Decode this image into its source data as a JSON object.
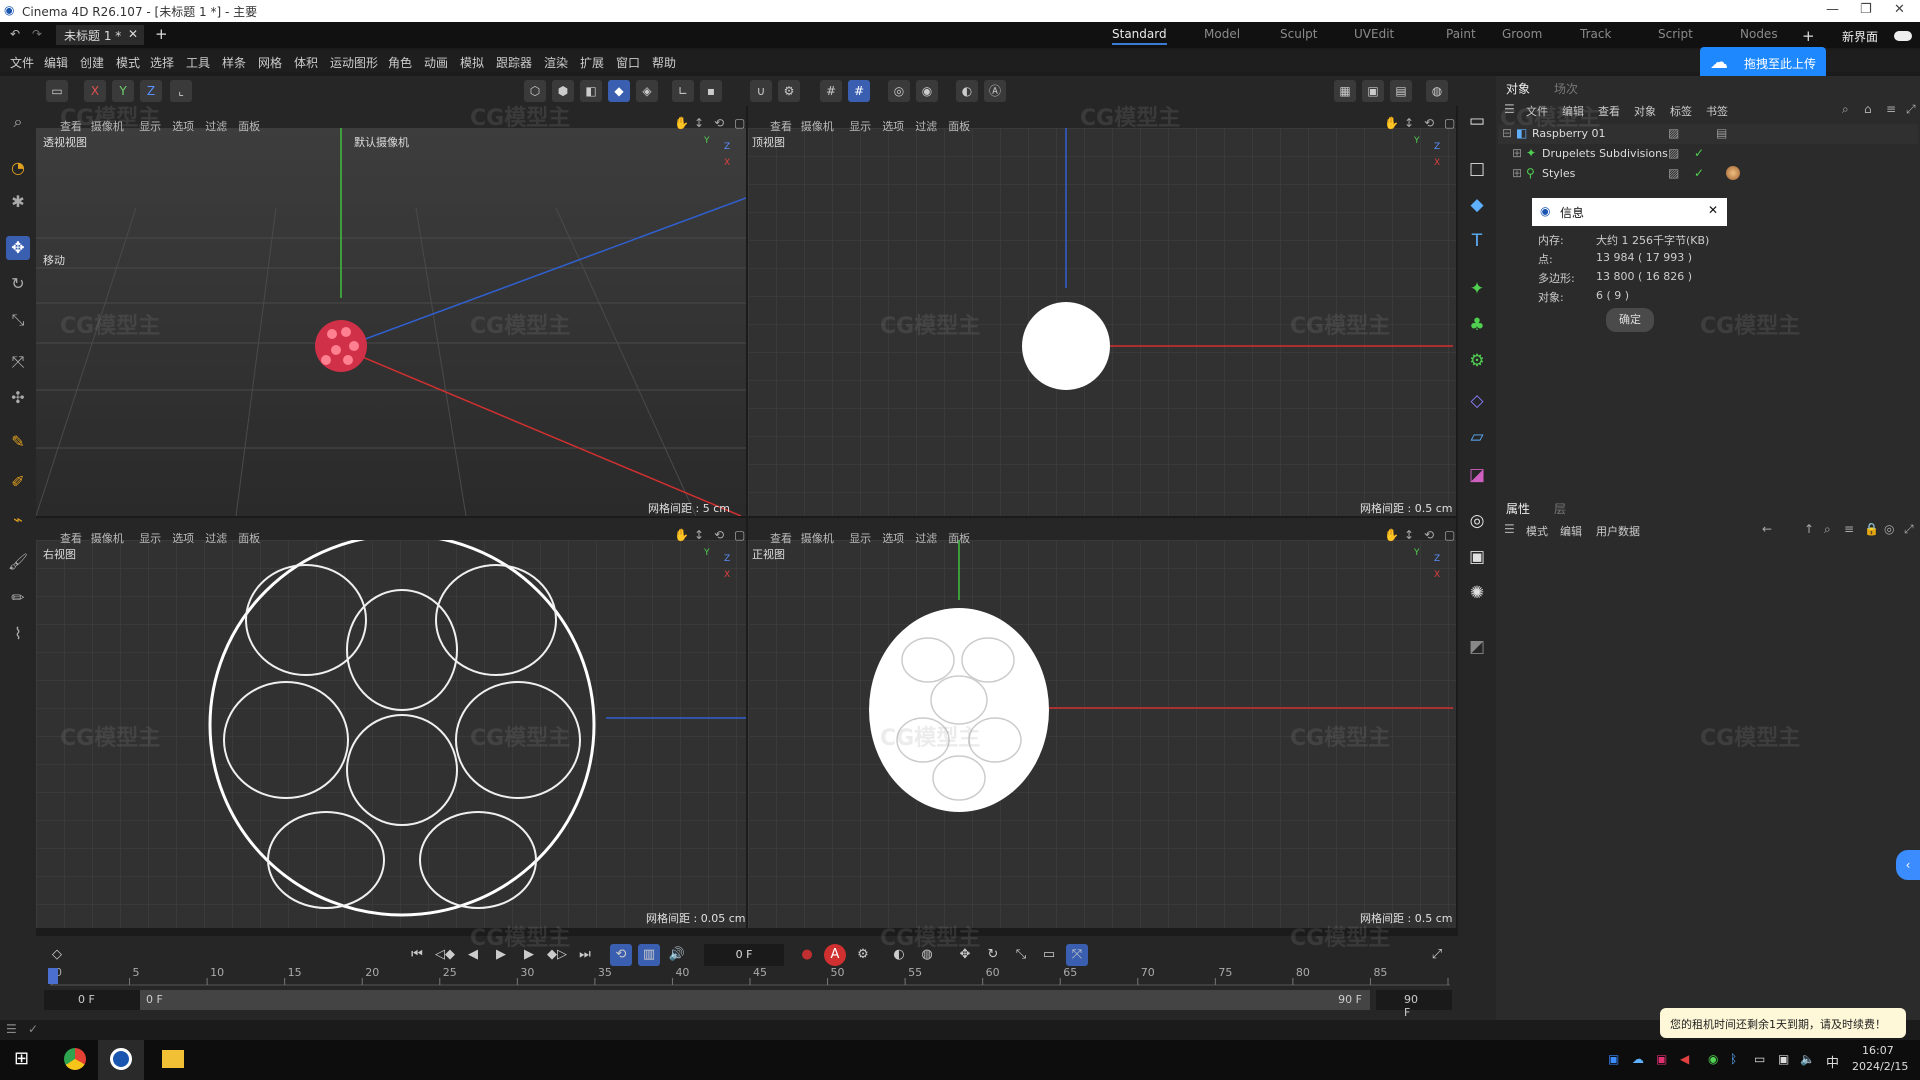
{
  "window": {
    "title": "Cinema 4D R26.107 - [未标题 1 *] - 主要",
    "doc_tab": "未标题 1 *",
    "add_tab": "+"
  },
  "layouts": {
    "items": [
      "Standard",
      "Model",
      "Sculpt",
      "UVEdit",
      "Paint",
      "Groom",
      "Track",
      "Script",
      "Nodes"
    ],
    "active": "Standard",
    "new_ui": "新界面"
  },
  "menu": [
    "文件",
    "编辑",
    "创建",
    "模式",
    "选择",
    "工具",
    "样条",
    "网格",
    "体积",
    "运动图形",
    "角色",
    "动画",
    "模拟",
    "跟踪器",
    "渲染",
    "扩展",
    "窗口",
    "帮助"
  ],
  "upload_button": "拖拽至此上传",
  "toolbar": {
    "axis_x": "X",
    "axis_y": "Y",
    "axis_z": "Z"
  },
  "viewport_menu": [
    "查看",
    "摄像机",
    "显示",
    "选项",
    "过滤",
    "面板"
  ],
  "viewports": {
    "perspective": {
      "label": "透视视图",
      "camera": "默认摄像机",
      "move_label": "移动",
      "grid": "网格间距 : 5 cm"
    },
    "top": {
      "label": "顶视图",
      "grid": "网格间距 : 0.5 cm"
    },
    "right": {
      "label": "右视图",
      "grid": "网格间距 : 0.05 cm"
    },
    "front": {
      "label": "正视图",
      "grid": "网格间距 : 0.5 cm"
    }
  },
  "axis_labels": {
    "x": "X",
    "y": "Y",
    "z": "Z"
  },
  "object_panel": {
    "tabs": [
      "对象",
      "场次"
    ],
    "menu": [
      "文件",
      "编辑",
      "查看",
      "对象",
      "标签",
      "书签"
    ],
    "objects": [
      "Raspberry 01",
      "Drupelets Subdivisions",
      "Styles"
    ]
  },
  "info_dialog": {
    "title": "信息",
    "rows": [
      {
        "k": "内存:",
        "v": "大约 1 256千字节(KB)"
      },
      {
        "k": "点:",
        "v": "13 984 ( 17 993 )"
      },
      {
        "k": "多边形:",
        "v": "13 800 ( 16 826 )"
      },
      {
        "k": "对象:",
        "v": "6 ( 9 )"
      }
    ],
    "ok": "确定"
  },
  "attr_panel": {
    "tabs": [
      "属性",
      "层"
    ],
    "menu": [
      "模式",
      "编辑",
      "用户数据"
    ]
  },
  "timeline": {
    "current_frame": "0 F",
    "ticks": [
      "0",
      "5",
      "10",
      "15",
      "20",
      "25",
      "30",
      "35",
      "40",
      "45",
      "50",
      "55",
      "60",
      "65",
      "70",
      "75",
      "80",
      "85",
      "90"
    ],
    "start": "0 F",
    "start2": "0 F",
    "end": "90 F",
    "end2": "90 F"
  },
  "notice": "您的租机时间还剩余1天到期，请及时续费！",
  "clock": {
    "time": "16:07",
    "date": "2024/2/15"
  },
  "ime": "中",
  "watermark": "CG模型主"
}
